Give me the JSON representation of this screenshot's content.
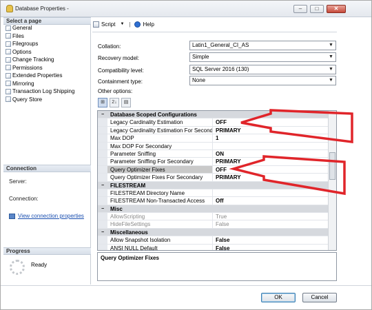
{
  "window": {
    "title": "Database Properties -"
  },
  "window_controls": {
    "minimize": "–",
    "maximize": "□",
    "close": "✕"
  },
  "left": {
    "select_page_title": "Select a page",
    "pages": [
      "General",
      "Files",
      "Filegroups",
      "Options",
      "Change Tracking",
      "Permissions",
      "Extended Properties",
      "Mirroring",
      "Transaction Log Shipping",
      "Query Store"
    ],
    "connection_title": "Connection",
    "server_label": "Server:",
    "connection_label": "Connection:",
    "view_connection_link": "View connection properties",
    "progress_title": "Progress",
    "status": "Ready"
  },
  "toolbar": {
    "script_label": "Script",
    "script_arrow": "▼",
    "separator": "|",
    "help_label": "Help"
  },
  "options": {
    "collation": {
      "label": "Collation:",
      "value": "Latin1_General_CI_AS"
    },
    "recovery_model": {
      "label": "Recovery model:",
      "value": "Simple"
    },
    "compatibility_level": {
      "label": "Compatibility level:",
      "value": "SQL Server 2016 (130)"
    },
    "containment_type": {
      "label": "Containment type:",
      "value": "None"
    },
    "other_options_label": "Other options:",
    "dropdown_arrow": "▼"
  },
  "grid_sort_buttons": [
    "⊞",
    "2↓",
    "▤"
  ],
  "grid": {
    "rows": [
      {
        "type": "cat",
        "name": "Database Scoped Configurations",
        "toggle": "−"
      },
      {
        "type": "prop",
        "name": "Legacy Cardinality Estimation",
        "value": "OFF"
      },
      {
        "type": "prop",
        "name": "Legacy Cardinality Estimation For Secondary",
        "value": "PRIMARY"
      },
      {
        "type": "prop",
        "name": "Max DOP",
        "value": "1"
      },
      {
        "type": "prop",
        "name": "Max DOP For Secondary",
        "value": ""
      },
      {
        "type": "prop",
        "name": "Parameter Sniffing",
        "value": "ON"
      },
      {
        "type": "prop",
        "name": "Parameter Sniffing For Secondary",
        "value": "PRIMARY"
      },
      {
        "type": "prop",
        "name": "Query Optimizer Fixes",
        "value": "OFF",
        "selected": true
      },
      {
        "type": "prop",
        "name": "Query Optimizer Fixes For Secondary",
        "value": "PRIMARY"
      },
      {
        "type": "cat",
        "name": "FILESTREAM",
        "toggle": "−"
      },
      {
        "type": "prop",
        "name": "FILESTREAM Directory Name",
        "value": ""
      },
      {
        "type": "prop",
        "name": "FILESTREAM Non-Transacted Access",
        "value": "Off"
      },
      {
        "type": "cat",
        "name": "Misc",
        "toggle": "−"
      },
      {
        "type": "prop",
        "name": "AllowScripting",
        "value": "True",
        "disabled": true
      },
      {
        "type": "prop",
        "name": "HideFileSettings",
        "value": "False",
        "disabled": true
      },
      {
        "type": "cat",
        "name": "Miscellaneous",
        "toggle": "−"
      },
      {
        "type": "prop",
        "name": "Allow Snapshot Isolation",
        "value": "False"
      },
      {
        "type": "prop",
        "name": "ANSI NULL Default",
        "value": "False"
      }
    ]
  },
  "description": "Query Optimizer Fixes",
  "buttons": {
    "ok": "OK",
    "cancel": "Cancel"
  },
  "annotation_color": "#e0252a"
}
